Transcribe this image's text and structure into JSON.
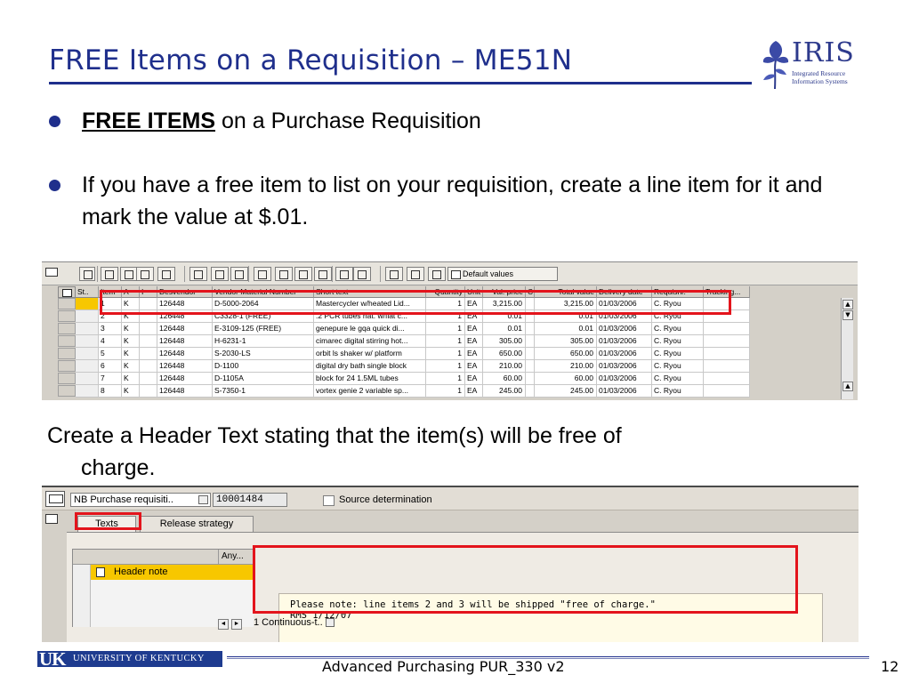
{
  "slide": {
    "title": "FREE Items on a Requisition – ME51N",
    "bullets": [
      {
        "bold": "FREE ITEMS",
        "text": " on a Purchase Requisition"
      },
      {
        "text": "If you have a free item to list on your requisition, create a line item for it and mark the value at $.01."
      }
    ],
    "header_text_line1": "Create a Header Text stating that the item(s) will be free of",
    "header_text_line2": "charge."
  },
  "logo": {
    "word": "IRIS",
    "sub1": "Integrated Resource",
    "sub2": "Information Systems"
  },
  "sap_items": {
    "default_values_button": "Default values",
    "headers": [
      "St..",
      "Item",
      "A",
      "I",
      "Desvendor",
      "Vendor Material Number",
      "Short text",
      "Quantity",
      "Unit",
      "Val. price",
      "C",
      "Total value",
      "Delivery date",
      "Requisnr.",
      "Tracking..."
    ],
    "rows": [
      [
        "1",
        "K",
        "126448",
        "D-5000-2064",
        "Mastercycler w/heated Lid...",
        "1",
        "EA",
        "3,215.00",
        "3,215.00",
        "01/03/2006",
        "C. Ryou"
      ],
      [
        "2",
        "K",
        "126448",
        "C3328-1 (FREE)",
        ".2 PCR tubes nat. w/flat c...",
        "1",
        "EA",
        "0.01",
        "0.01",
        "01/03/2006",
        "C. Ryou"
      ],
      [
        "3",
        "K",
        "126448",
        "E-3109-125 (FREE)",
        "genepure le gqa quick di...",
        "1",
        "EA",
        "0.01",
        "0.01",
        "01/03/2006",
        "C. Ryou"
      ],
      [
        "4",
        "K",
        "126448",
        "H-6231-1",
        "cimarec digital stirring hot...",
        "1",
        "EA",
        "305.00",
        "305.00",
        "01/03/2006",
        "C. Ryou"
      ],
      [
        "5",
        "K",
        "126448",
        "S-2030-LS",
        "orbit ls shaker w/ platform",
        "1",
        "EA",
        "650.00",
        "650.00",
        "01/03/2006",
        "C. Ryou"
      ],
      [
        "6",
        "K",
        "126448",
        "D-1100",
        "digital dry bath single block",
        "1",
        "EA",
        "210.00",
        "210.00",
        "01/03/2006",
        "C. Ryou"
      ],
      [
        "7",
        "K",
        "126448",
        "D-1105A",
        "block for 24 1.5ML tubes",
        "1",
        "EA",
        "60.00",
        "60.00",
        "01/03/2006",
        "C. Ryou"
      ],
      [
        "8",
        "K",
        "126448",
        "S-7350-1",
        "vortex genie 2 variable sp...",
        "1",
        "EA",
        "245.00",
        "245.00",
        "01/03/2006",
        "C. Ryou"
      ]
    ]
  },
  "sap_header": {
    "doc_type": "NB Purchase requisiti..",
    "doc_number": "10001484",
    "source_determination": "Source determination",
    "tabs": [
      "Texts",
      "Release strategy"
    ],
    "text_list_col": "Any...",
    "text_list_item": "Header note",
    "note_line1": "Please note: line items 2 and 3 will be shipped \"free of charge.\"",
    "note_line2": "RMS 1/12/07",
    "format": "1 Continuous-t..",
    "nav_prev": "◄",
    "nav_next": "►"
  },
  "footer": {
    "uk_mark": "UK",
    "uk_name": "UNIVERSITY OF KENTUCKY",
    "course": "Advanced Purchasing PUR_330 v2",
    "page": "12"
  },
  "colors": {
    "title_blue": "#1f2f8c",
    "highlight_red": "#e3141c",
    "selected_yellow": "#f7c700",
    "sap_grey": "#d4d0c8"
  }
}
